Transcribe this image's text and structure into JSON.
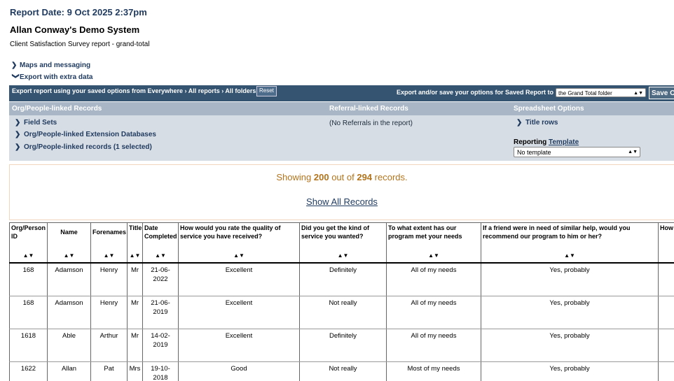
{
  "header": {
    "report_date": "Report Date: 9 Oct 2025 2:37pm",
    "system_name": "Allan Conway's Demo System",
    "report_subtitle": "Client Satisfaction Survey report - grand-total"
  },
  "toggles": {
    "maps": "Maps and messaging",
    "export": "Export with extra data"
  },
  "export_bar": {
    "left_text": "Export report using your saved options from Everywhere › All reports › All folders",
    "reset_label": "Reset",
    "right_text": "Export and/or save your options for Saved Report to",
    "folder_value": "the Grand Total folder",
    "save_label": "Save O"
  },
  "options": {
    "col1_header": "Org/People-linked Records",
    "col2_header": "Referral-linked Records",
    "col3_header": "Spreadsheet Options",
    "field_sets": "Field Sets",
    "extension_dbs": "Org/People-linked Extension Databases",
    "linked_records": "Org/People-linked records (1 selected)",
    "no_referrals": "(No Referrals in the report)",
    "title_rows": "Title rows",
    "reporting_label": "Reporting",
    "template_link": "Template",
    "template_value": "No template"
  },
  "summary": {
    "showing_prefix": "Showing",
    "shown_count": "200",
    "out_of": "out of",
    "total_count": "294",
    "records_suffix": "records.",
    "show_all": "Show All Records"
  },
  "table": {
    "sort_glyph": "▲▼",
    "headers": [
      "Org/Person ID",
      "Name",
      "Forenames",
      "Title",
      "Date Completed",
      "How would you rate the quality of service you have received?",
      "Did you get the kind of service you wanted?",
      "To what extent has our program met your needs",
      "If a friend were in need of similar help, would you recommend our program to him or her?",
      "How help"
    ],
    "rows": [
      [
        "168",
        "Adamson",
        "Henry",
        "Mr",
        "21-06-2022",
        "Excellent",
        "Definitely",
        "All of my needs",
        "Yes, probably",
        ""
      ],
      [
        "168",
        "Adamson",
        "Henry",
        "Mr",
        "21-06-2019",
        "Excellent",
        "Not really",
        "All of my needs",
        "Yes, probably",
        ""
      ],
      [
        "1618",
        "Able",
        "Arthur",
        "Mr",
        "14-02-2019",
        "Excellent",
        "Definitely",
        "All of my needs",
        "Yes, probably",
        ""
      ],
      [
        "1622",
        "Allan",
        "Pat",
        "Mrs",
        "19-10-2018",
        "Good",
        "Not really",
        "Most of my needs",
        "Yes, probably",
        ""
      ]
    ]
  }
}
